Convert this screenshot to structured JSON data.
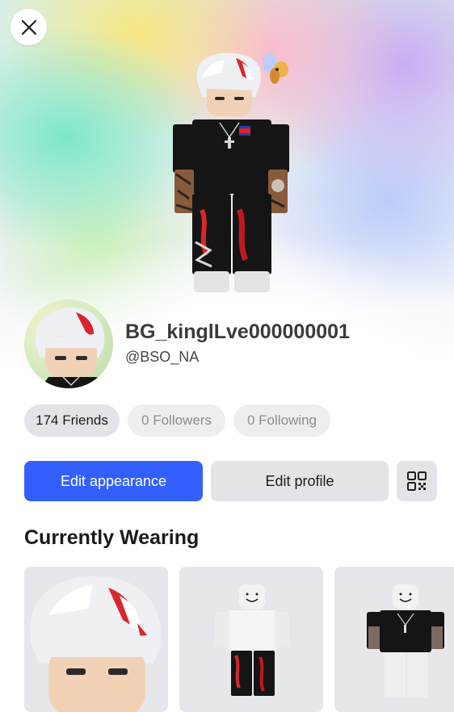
{
  "profile": {
    "display_name": "BG_kinglLve000000001",
    "username": "@BSO_NA"
  },
  "stats": {
    "friends": "174 Friends",
    "followers": "0 Followers",
    "following": "0 Following"
  },
  "actions": {
    "edit_appearance": "Edit appearance",
    "edit_profile": "Edit profile"
  },
  "wearing": {
    "title": "Currently Wearing",
    "items": [
      {
        "icon": "hair-item-thumbnail"
      },
      {
        "icon": "outfit-item-thumbnail"
      },
      {
        "icon": "shirt-item-thumbnail"
      }
    ]
  },
  "colors": {
    "primary": "#335fff",
    "secondary_button": "#e3e4e8"
  }
}
